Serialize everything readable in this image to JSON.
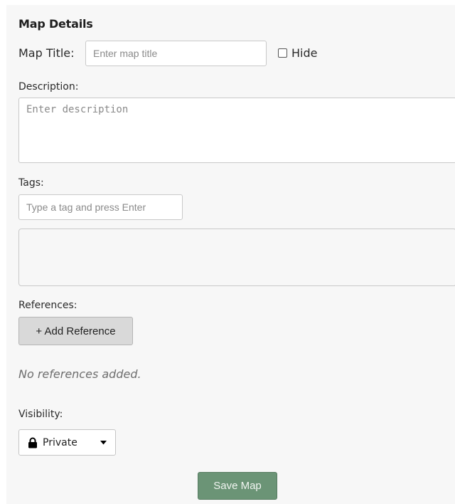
{
  "section": {
    "heading": "Map Details"
  },
  "map_title": {
    "label": "Map Title:",
    "value": "",
    "placeholder": "Enter map title",
    "hide_label": "Hide",
    "hide_checked": false
  },
  "description": {
    "label": "Description:",
    "value": "",
    "placeholder": "Enter description"
  },
  "tags": {
    "label": "Tags:",
    "value": "",
    "placeholder": "Type a tag and press Enter",
    "items": []
  },
  "references": {
    "label": "References:",
    "add_button_label": "+ Add Reference",
    "empty_text": "No references added."
  },
  "visibility": {
    "label": "Visibility:",
    "selected": "Private",
    "icon": "lock-icon"
  },
  "actions": {
    "save_label": "Save Map",
    "save_color": "#6b9476"
  }
}
